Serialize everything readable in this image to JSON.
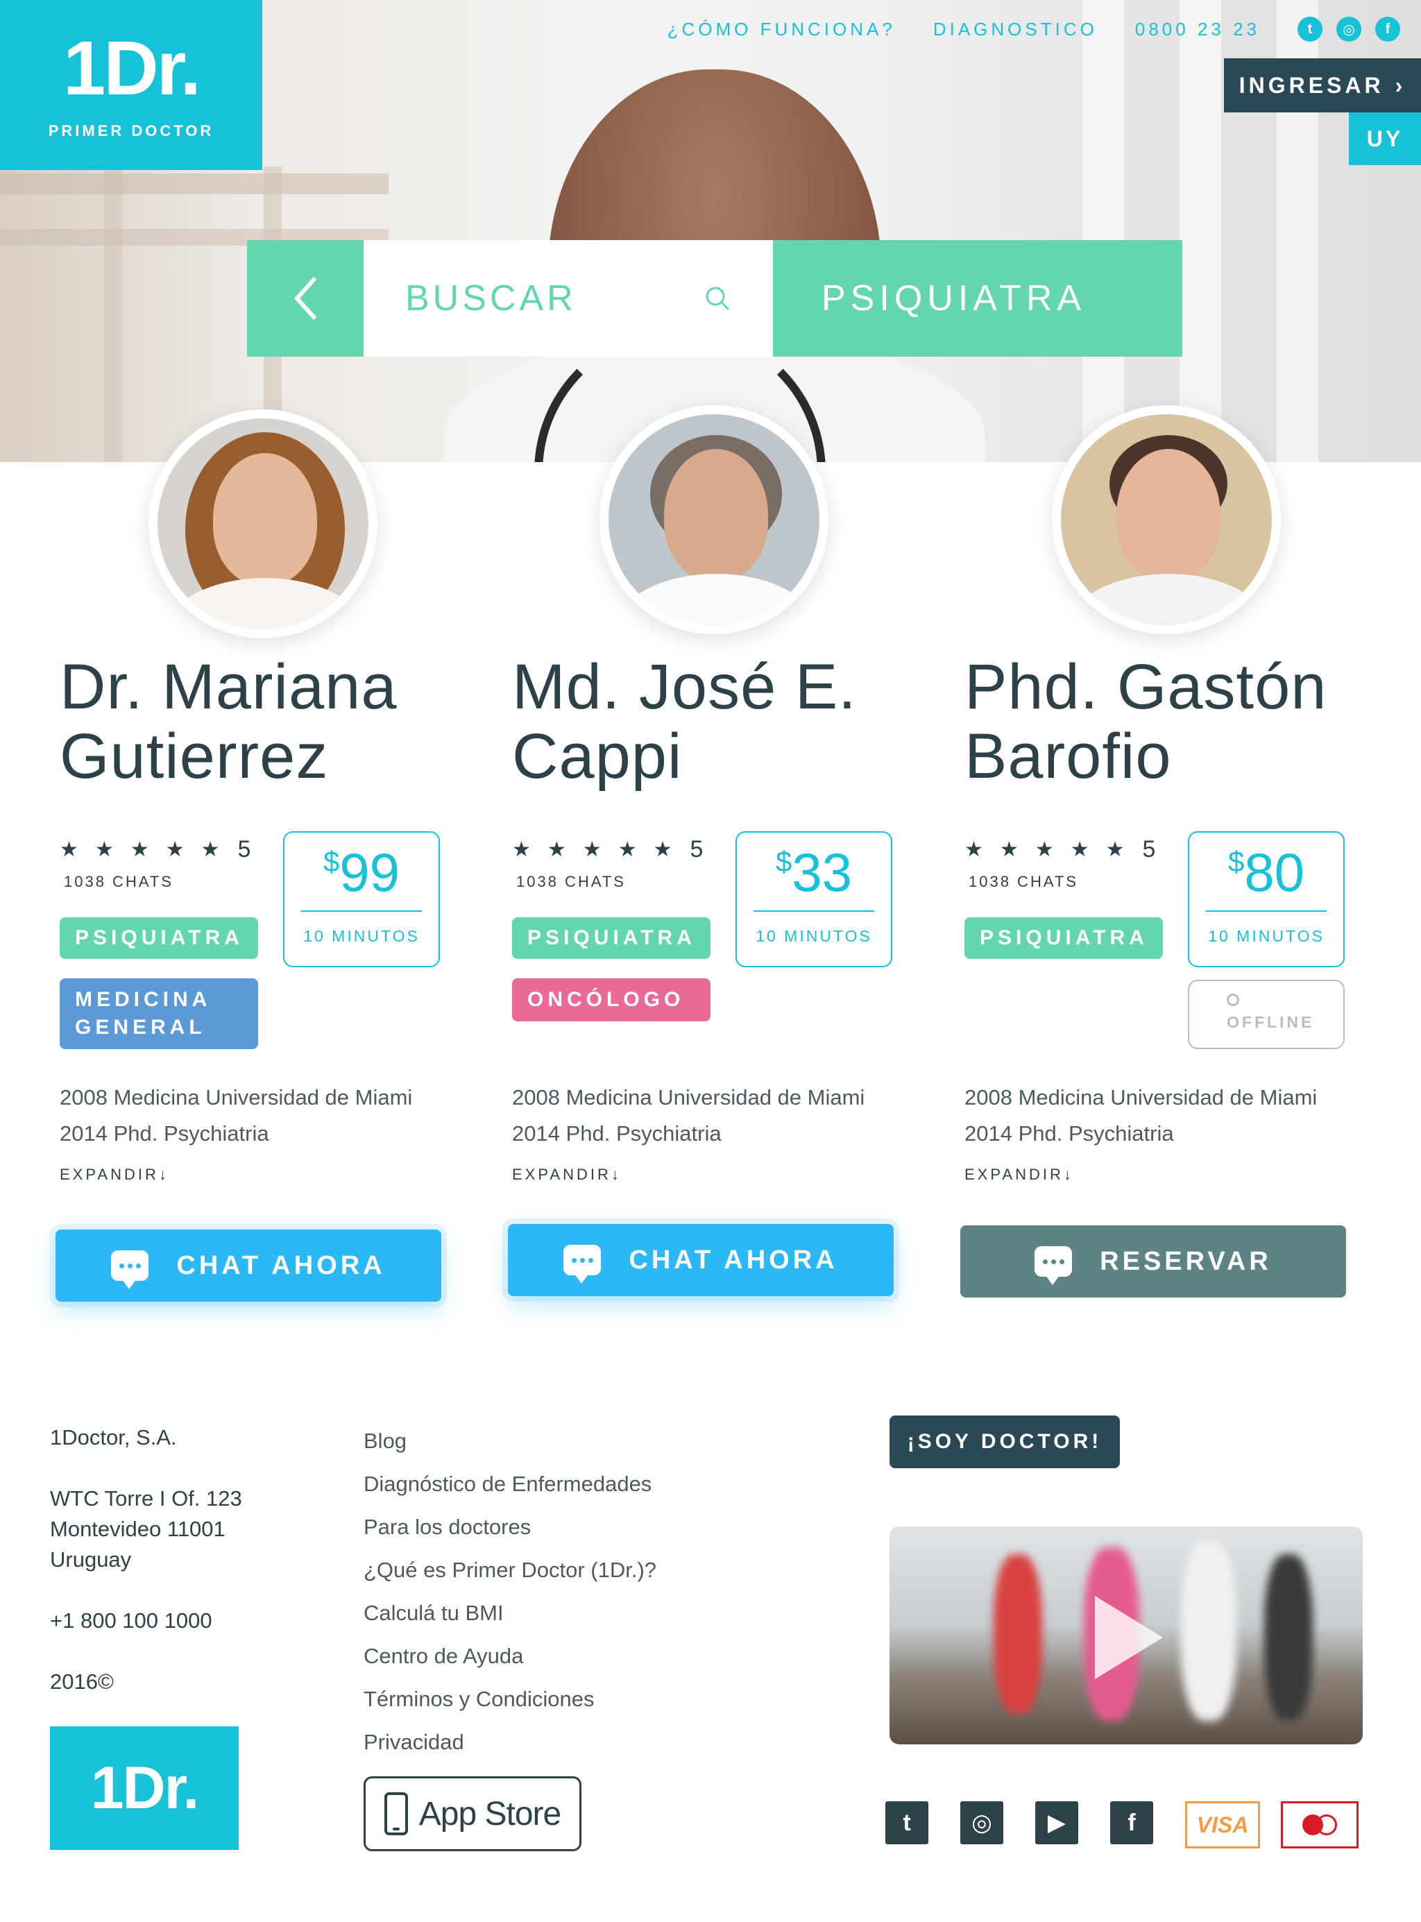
{
  "brand": {
    "logo": "1Dr.",
    "tagline": "PRIMER DOCTOR"
  },
  "nav": {
    "links": [
      "¿CÓMO FUNCIONA?",
      "DIAGNOSTICO",
      "0800 23 23"
    ],
    "social_icons": [
      "twitter-icon",
      "instagram-icon",
      "facebook-icon"
    ],
    "login_label": "INGRESAR",
    "country": "UY"
  },
  "search": {
    "placeholder": "BUSCAR",
    "specialty": "PSIQUIATRA"
  },
  "doctors": [
    {
      "name": "Dr. Mariana Gutierrez",
      "rating": "5",
      "chats": "1038 CHATS",
      "price": "99",
      "currency": "$",
      "duration": "10 MINUTOS",
      "tags": [
        "PSIQUIATRA",
        "MEDICINA GENERAL"
      ],
      "education": [
        "2008 Medicina Universidad de Miami",
        "2014 Phd. Psychiatria"
      ],
      "expand": "EXPANDIR",
      "cta": "CHAT AHORA",
      "status": "online"
    },
    {
      "name": "Md. José E. Cappi",
      "rating": "5",
      "chats": "1038 CHATS",
      "price": "33",
      "currency": "$",
      "duration": "10 MINUTOS",
      "tags": [
        "PSIQUIATRA",
        "ONCÓLOGO"
      ],
      "education": [
        "2008 Medicina Universidad de Miami",
        "2014 Phd. Psychiatria"
      ],
      "expand": "EXPANDIR",
      "cta": "CHAT AHORA",
      "status": "online"
    },
    {
      "name": "Phd. Gastón Barofio",
      "rating": "5",
      "chats": "1038 CHATS",
      "price": "80",
      "currency": "$",
      "duration": "10 MINUTOS",
      "tags": [
        "PSIQUIATRA"
      ],
      "offline_label": "OFFLINE",
      "education": [
        "2008 Medicina Universidad de Miami",
        "2014 Phd. Psychiatria"
      ],
      "expand": "EXPANDIR",
      "cta": "RESERVAR",
      "status": "offline"
    }
  ],
  "footer": {
    "company": "1Doctor, S.A.",
    "address": [
      "WTC Torre I Of. 123",
      "Montevideo 11001",
      "Uruguay"
    ],
    "phone": "+1 800 100 1000",
    "year": "2016©",
    "logo": "1Dr.",
    "links": [
      "Blog",
      "Diagnóstico de Enfermedades",
      "Para los doctores",
      "¿Qué es Primer Doctor (1Dr.)?",
      "Calculá tu BMI",
      "Centro de Ayuda",
      "Términos y Condiciones",
      "Privacidad"
    ],
    "app_store": "App Store",
    "doctor_button": "¡SOY DOCTOR!",
    "social_icons": [
      "twitter-icon",
      "instagram-icon",
      "youtube-icon",
      "facebook-icon"
    ],
    "payment": [
      "VISA",
      "mastercard-icon"
    ]
  },
  "colors": {
    "cyan": "#17c1d7",
    "mint": "#64d6ad",
    "navy": "#2b4954",
    "blue": "#2cb7f7",
    "gray_button": "#5e8384",
    "tag_blue": "#5b9ad7",
    "tag_pink": "#ea6a97"
  }
}
